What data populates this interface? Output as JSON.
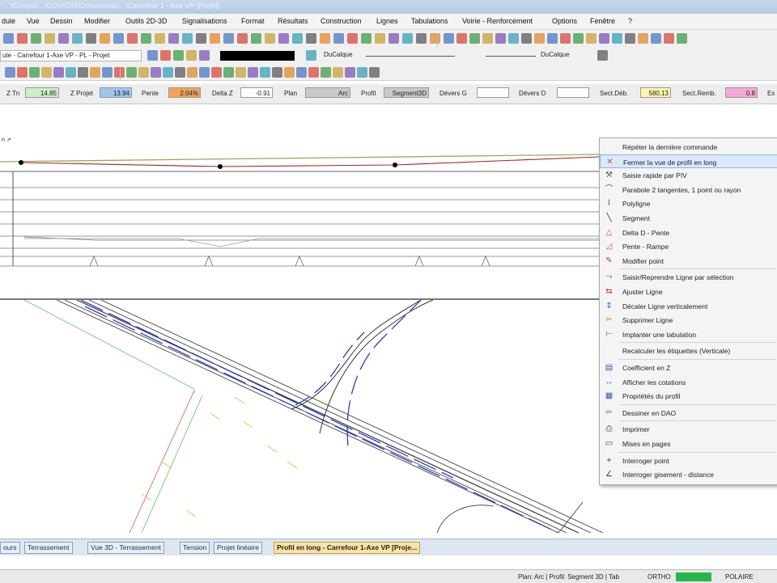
{
  "window": {
    "title": "…\\Compo\\...\\COVADIS\\Documents\\...\\Carrefour 1 - Axe VP [Projet]"
  },
  "menu": [
    "dule",
    "Vue",
    "Dessin",
    "Modifier",
    "Outils 2D-3D",
    "Signalisations",
    "Format",
    "Résultats",
    "Construction",
    "Lignes",
    "Tabulations",
    "Voirie - Renforcement",
    "Options",
    "Fenêtre",
    "?"
  ],
  "toolbar2": {
    "profile_selector": "ute - Carrefour 1-Axe VP - PL - Projet",
    "layer_left": "DuCalque",
    "layer_right": "DuCalque"
  },
  "fields": [
    {
      "label": "Z Tn",
      "value": "14.85",
      "color": "#cdeec8"
    },
    {
      "label": "Z Projet",
      "value": "13.94",
      "color": "#9ec6ee"
    },
    {
      "label": "Pente",
      "value": "2.04%",
      "color": "#f2a25b"
    },
    {
      "label": "Delta Z",
      "value": "-0.91",
      "color": "#ffffff"
    },
    {
      "label": "Plan",
      "value": "Arc",
      "color": "#c9c9c9"
    },
    {
      "label": "Profil",
      "value": "Segment3D",
      "color": "#c9c9c9"
    },
    {
      "label": "Dévers G",
      "value": "",
      "color": "#ffffff"
    },
    {
      "label": "Dévers D",
      "value": "",
      "color": "#ffffff"
    },
    {
      "label": "Sect.Déb.",
      "value": "580.13",
      "color": "#fff6a8"
    },
    {
      "label": "Sect.Remb.",
      "value": "0.8",
      "color": "#f6a8d6"
    },
    {
      "label": "Ex",
      "value": "",
      "color": "#ffffff"
    }
  ],
  "profile": {
    "corner_label": "n ↗"
  },
  "context_menu": [
    {
      "label": "Répéter la dernière commande",
      "icon": "none",
      "sep_before": false
    },
    {
      "label": "Fermer la vue de profil en long",
      "icon": "close-profile-icon",
      "sep_before": false,
      "highlighted": true
    },
    {
      "label": "Saisie rapide par PIV",
      "icon": "piv-icon",
      "sep_before": false
    },
    {
      "label": "Parabole 2 tangentes, 1 point ou rayon",
      "icon": "parabola-icon",
      "sep_before": false
    },
    {
      "label": "Polyligne",
      "icon": "polyline-icon",
      "sep_before": false
    },
    {
      "label": "Segment",
      "icon": "segment-icon",
      "sep_before": false
    },
    {
      "label": "Delta D - Pente",
      "icon": "delta-slope-icon",
      "sep_before": false
    },
    {
      "label": "Pente - Rampe",
      "icon": "slope-ramp-icon",
      "sep_before": false
    },
    {
      "label": "Modifier point",
      "icon": "edit-point-icon",
      "sep_before": false
    },
    {
      "label": "Saisir/Reprendre Ligne par sélection",
      "icon": "select-line-icon",
      "sep_before": true
    },
    {
      "label": "Ajuster Ligne",
      "icon": "adjust-line-icon",
      "sep_before": false
    },
    {
      "label": "Décaler Ligne verticalement",
      "icon": "offset-line-icon",
      "sep_before": false
    },
    {
      "label": "Supprimer Ligne",
      "icon": "delete-line-icon",
      "sep_before": false
    },
    {
      "label": "Implanter une tabulation",
      "icon": "tabulation-icon",
      "sep_before": false
    },
    {
      "label": "Recalculer les étiquettes (Verticale)",
      "icon": "none",
      "sep_before": true
    },
    {
      "label": "Coefficient en Z",
      "icon": "z-coef-icon",
      "sep_before": true
    },
    {
      "label": "Afficher les cotations",
      "icon": "dimensions-icon",
      "sep_before": false
    },
    {
      "label": "Propriétés du profil",
      "icon": "properties-icon",
      "sep_before": false
    },
    {
      "label": "Dessiner en DAO",
      "icon": "cad-draw-icon",
      "sep_before": true
    },
    {
      "label": "Imprimer",
      "icon": "print-icon",
      "sep_before": true
    },
    {
      "label": "Mises en pages",
      "icon": "layout-icon",
      "sep_before": false
    },
    {
      "label": "Interroger point",
      "icon": "query-point-icon",
      "sep_before": true
    },
    {
      "label": "Interroger gisement - distance",
      "icon": "bearing-icon",
      "sep_before": false
    }
  ],
  "tabs": [
    {
      "label": "ours",
      "active": false
    },
    {
      "label": "Terrassement",
      "active": false
    },
    {
      "label": "Vue 3D - Terrassement",
      "active": false
    },
    {
      "label": "Tension",
      "active": false
    },
    {
      "label": "Projet linéaire",
      "active": false
    },
    {
      "label": "Profil en long - Carrefour 1-Axe VP [Proje...",
      "active": true
    }
  ],
  "statusbar": {
    "plan_info": "Plan: Arc | Profil: Segment 3D | Tab",
    "ortho": "ORTHO",
    "polaire": "POLAIRE"
  }
}
